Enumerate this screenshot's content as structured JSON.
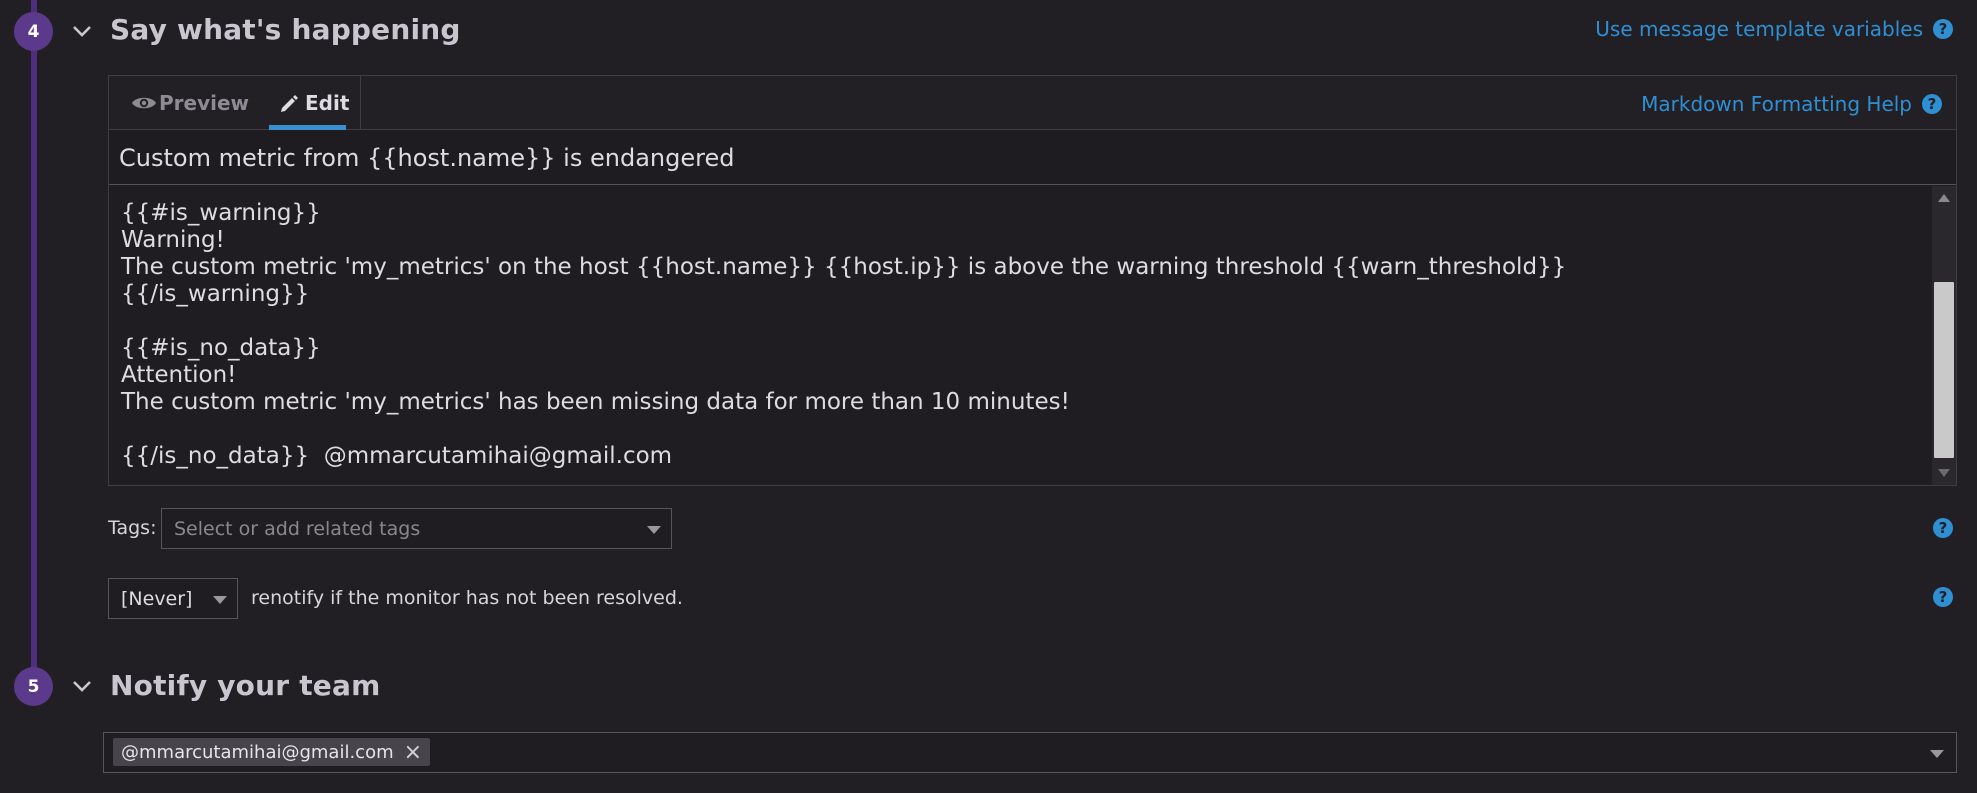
{
  "step4": {
    "number": "4",
    "title": "Say what's happening",
    "template_link": "Use message template variables",
    "help_glyph": "?"
  },
  "editor": {
    "tabs": [
      {
        "label": "Preview",
        "icon": "eye-icon"
      },
      {
        "label": "Edit",
        "icon": "pencil-icon"
      }
    ],
    "markdown_help": "Markdown Formatting Help",
    "subject": "Custom metric from {{host.name}} is endangered",
    "body_lines": [
      "{{#is_warning}}",
      "Warning!",
      "The custom metric 'my_metrics' on the host {{host.name}} {{host.ip}} is above the warning threshold {{warn_threshold}}",
      "{{/is_warning}}",
      "",
      "{{#is_no_data}}",
      "Attention!",
      "The custom metric 'my_metrics' has been missing data for more than 10 minutes!",
      "",
      "{{/is_no_data}}  @mmarcutamihai@gmail.com"
    ]
  },
  "tags": {
    "label": "Tags:",
    "placeholder": "Select or add related tags"
  },
  "renotify": {
    "selected": "[Never]",
    "text": "renotify if the monitor has not been resolved."
  },
  "step5": {
    "number": "5",
    "title": "Notify your team",
    "recipients": [
      "@mmarcutamihai@gmail.com"
    ],
    "remove_glyph": "×"
  },
  "colors": {
    "background": "#211f24",
    "accent_purple": "#5b3a8c",
    "link_blue": "#2f8fd3",
    "tab_underline": "#3a8fd0"
  }
}
